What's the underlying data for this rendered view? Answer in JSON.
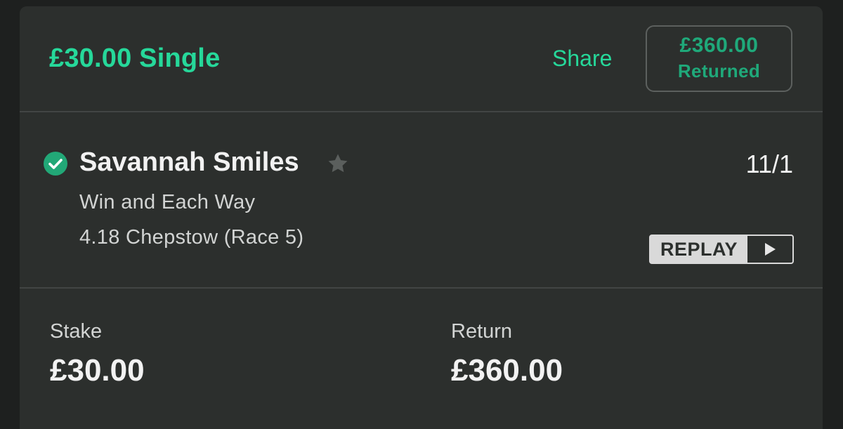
{
  "header": {
    "bet_title": "£30.00 Single",
    "share_label": "Share",
    "returned_amount": "£360.00",
    "returned_label": "Returned"
  },
  "selection": {
    "status_icon": "check-circle-icon",
    "runner_name": "Savannah Smiles",
    "favourite_icon": "star-icon",
    "odds": "11/1",
    "market": "Win and Each Way",
    "event": "4.18 Chepstow (Race 5)",
    "replay_label": "REPLAY",
    "replay_icon": "play-icon"
  },
  "totals": {
    "stake_label": "Stake",
    "stake_value": "£30.00",
    "return_label": "Return",
    "return_value": "£360.00"
  },
  "colors": {
    "accent": "#26d89a",
    "card_background": "#2c2f2d",
    "page_background": "#1e201f",
    "check_green": "#22a877"
  }
}
